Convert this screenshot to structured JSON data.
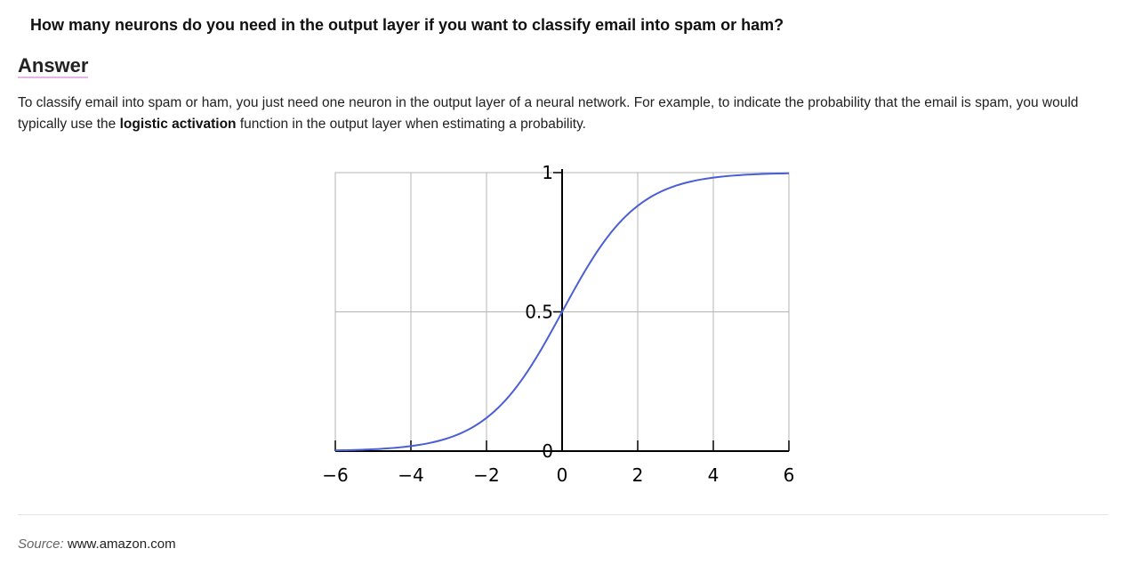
{
  "question": "How many neurons do you need in the output layer if you want to classify email into spam or ham?",
  "answer": {
    "heading": "Answer",
    "text_part1": "To classify email into spam or ham, you just need one neuron in the output layer of a neural network. For example, to indicate the probability that the email is spam, you would typically use the ",
    "text_bold": "logistic activation",
    "text_part2": " function in the output layer when estimating a probability."
  },
  "chart_data": {
    "type": "line",
    "function": "logistic",
    "title": "",
    "xlabel": "",
    "ylabel": "",
    "xlim": [
      -6,
      6
    ],
    "ylim": [
      0,
      1
    ],
    "x_ticks": [
      -6,
      -4,
      -2,
      0,
      2,
      4,
      6
    ],
    "x_tick_labels": [
      "−6",
      "−4",
      "−2",
      "0",
      "2",
      "4",
      "6"
    ],
    "y_ticks": [
      0,
      0.5,
      1
    ],
    "y_tick_labels": [
      "0",
      "0.5",
      "1"
    ],
    "grid": true,
    "series": [
      {
        "color": "#4a5fd4",
        "x": [
          -6,
          -5,
          -4,
          -3,
          -2,
          -1,
          0,
          1,
          2,
          3,
          4,
          5,
          6
        ],
        "y": [
          0.0025,
          0.0067,
          0.018,
          0.047,
          0.119,
          0.269,
          0.5,
          0.731,
          0.881,
          0.953,
          0.982,
          0.9933,
          0.9975
        ]
      }
    ]
  },
  "source": {
    "label": "Source:",
    "link_text": "www.amazon.com"
  }
}
